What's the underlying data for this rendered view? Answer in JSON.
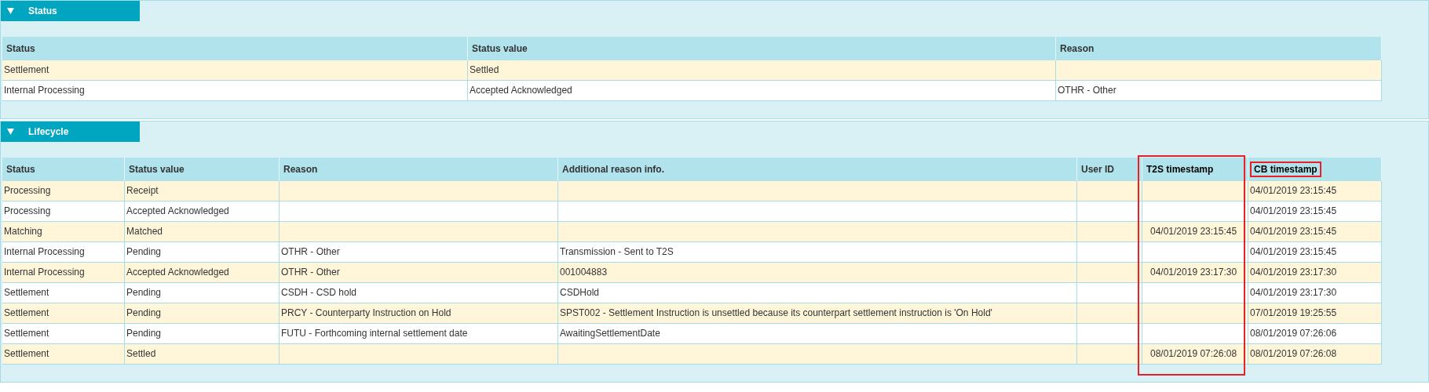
{
  "sections": [
    {
      "title": "Status",
      "expanded": true,
      "table": {
        "columns": [
          {
            "label": "Status"
          },
          {
            "label": "Status value"
          },
          {
            "label": "Reason"
          }
        ],
        "rows": [
          [
            "Settlement",
            "Settled",
            ""
          ],
          [
            "Internal Processing",
            "Accepted Acknowledged",
            "OTHR - Other"
          ]
        ]
      }
    },
    {
      "title": "Lifecycle",
      "expanded": true,
      "table": {
        "columns": [
          {
            "label": "Status"
          },
          {
            "label": "Status value"
          },
          {
            "label": "Reason"
          },
          {
            "label": "Additional reason info."
          },
          {
            "label": "User ID"
          },
          {
            "label": "T2S timestamp",
            "column_framed": true,
            "label_framed": false
          },
          {
            "label": "CB timestamp",
            "column_framed": false,
            "label_framed": true
          }
        ],
        "rows": [
          [
            "Processing",
            "Receipt",
            "",
            "",
            "",
            "",
            "04/01/2019 23:15:45"
          ],
          [
            "Processing",
            "Accepted Acknowledged",
            "",
            "",
            "",
            "",
            "04/01/2019 23:15:45"
          ],
          [
            "Matching",
            "Matched",
            "",
            "",
            "",
            "04/01/2019 23:15:45",
            "04/01/2019 23:15:45"
          ],
          [
            "Internal Processing",
            "Pending",
            "OTHR - Other",
            "Transmission - Sent to T2S",
            "",
            "",
            "04/01/2019 23:15:45"
          ],
          [
            "Internal Processing",
            "Accepted Acknowledged",
            "OTHR - Other",
            "001004883",
            "",
            "04/01/2019 23:17:30",
            "04/01/2019 23:17:30"
          ],
          [
            "Settlement",
            "Pending",
            "CSDH - CSD hold",
            "CSDHold",
            "",
            "",
            "04/01/2019 23:17:30"
          ],
          [
            "Settlement",
            "Pending",
            "PRCY - Counterparty Instruction on Hold",
            "SPST002 - Settlement Instruction is unsettled because its counterpart settlement instruction is 'On Hold'",
            "",
            "",
            "07/01/2019 19:25:55"
          ],
          [
            "Settlement",
            "Pending",
            "FUTU - Forthcoming internal settlement date",
            "AwaitingSettlementDate",
            "",
            "",
            "08/01/2019 07:26:06"
          ],
          [
            "Settlement",
            "Settled",
            "",
            "",
            "",
            "08/01/2019 07:26:08",
            "08/01/2019 07:26:08"
          ]
        ]
      }
    }
  ]
}
